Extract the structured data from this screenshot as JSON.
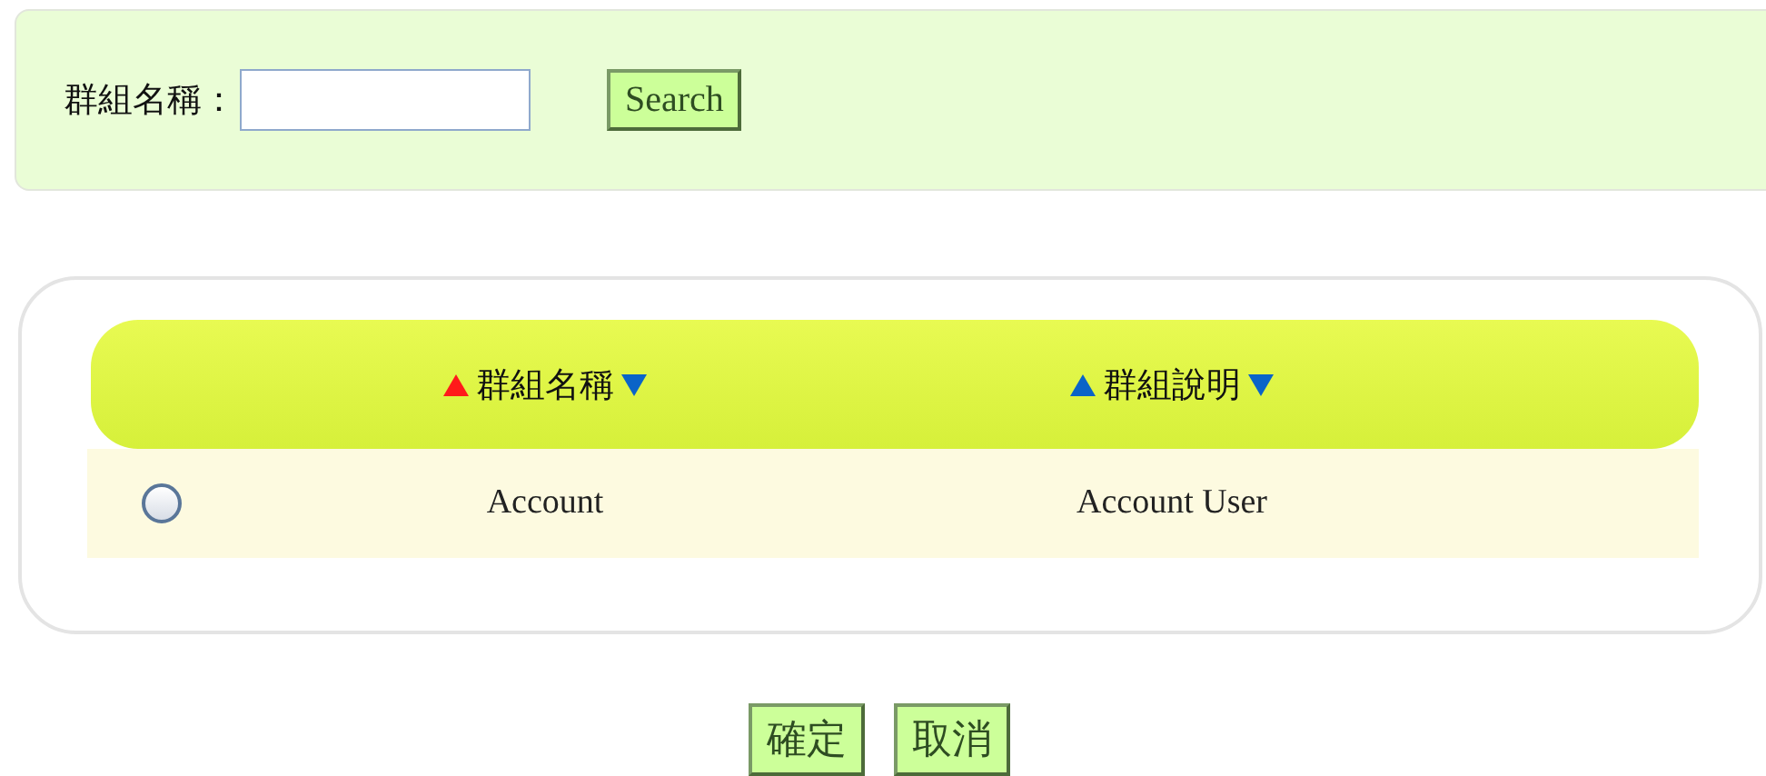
{
  "search": {
    "label": "群組名稱：",
    "button": "Search"
  },
  "table": {
    "columns": [
      {
        "label": "群組名稱",
        "sorted": true
      },
      {
        "label": "群組說明",
        "sorted": false
      }
    ],
    "rows": [
      {
        "selected": false,
        "cells": [
          "Account",
          "Account User"
        ]
      }
    ]
  },
  "buttons": [
    "確定",
    "取消"
  ]
}
